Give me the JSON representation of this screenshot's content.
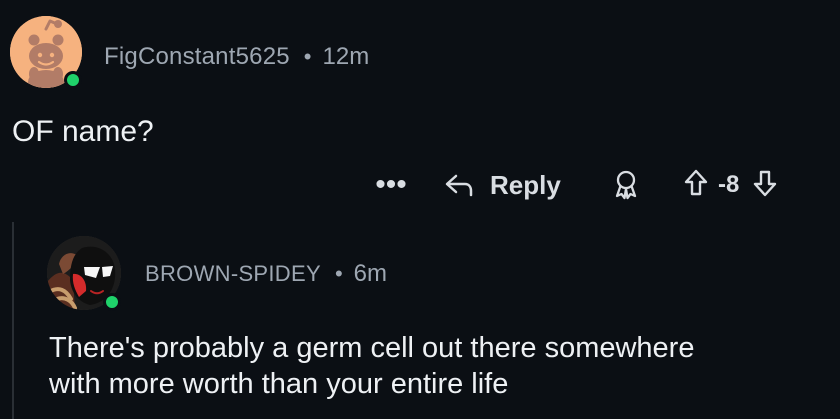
{
  "comment": {
    "author": "FigConstant5625",
    "time": "12m",
    "body": "OF name?",
    "actions": {
      "more_label": "•••",
      "reply_label": "Reply",
      "score": "-8"
    }
  },
  "reply": {
    "author": "BROWN-SPIDEY",
    "time": "6m",
    "body_lines": [
      "There's probably a germ cell out there somewhere",
      "with more worth than your entire life"
    ]
  },
  "ui": {
    "separator": "•",
    "online_status_color": "#1fd26a",
    "background_color": "#0b0f14",
    "text_color": "#eef1f4",
    "muted_text_color": "#9ea7b2"
  }
}
